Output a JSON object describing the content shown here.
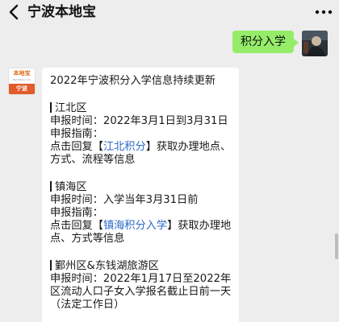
{
  "header": {
    "title": "宁波本地宝",
    "back_icon": "chevron-left-icon",
    "more_icon": "more-dots-icon"
  },
  "outgoing": {
    "text": "积分入学"
  },
  "bot_avatar": {
    "logo_text": "本地宝",
    "site_text": "Bendibao.com",
    "city_text": "宁波"
  },
  "bubble": {
    "heading": "2022年宁波积分入学信息持续更新",
    "sections": [
      {
        "name": "江北区",
        "time_line": "申报时间：2022年3月1日到3月31日",
        "guide_label": "申报指南：",
        "reply_prefix": "点击回复【",
        "reply_keyword": "江北积分",
        "reply_suffix": "】获取办理地点、",
        "reply_tail": "方式、流程等信息"
      },
      {
        "name": "镇海区",
        "time_line": "申报时间：入学当年3月31日前",
        "guide_label": "申报指南：",
        "reply_prefix": "点击回复【",
        "reply_keyword": "镇海积分入学",
        "reply_suffix": "】获取办理地",
        "reply_tail": "点、方式等信息"
      },
      {
        "name": "鄞州区&东钱湖旅游区",
        "time_line": "申报时间：2022年1月17日至2022年",
        "time_line2": "区流动人口子女入学报名截止日前一天",
        "time_line3": "（法定工作日）"
      }
    ]
  },
  "colors": {
    "background": "#ededed",
    "outgoing_bubble": "#95ec69",
    "incoming_bubble": "#ffffff",
    "link": "#2b6ac8",
    "avatar_accent": "#e25b2a"
  }
}
